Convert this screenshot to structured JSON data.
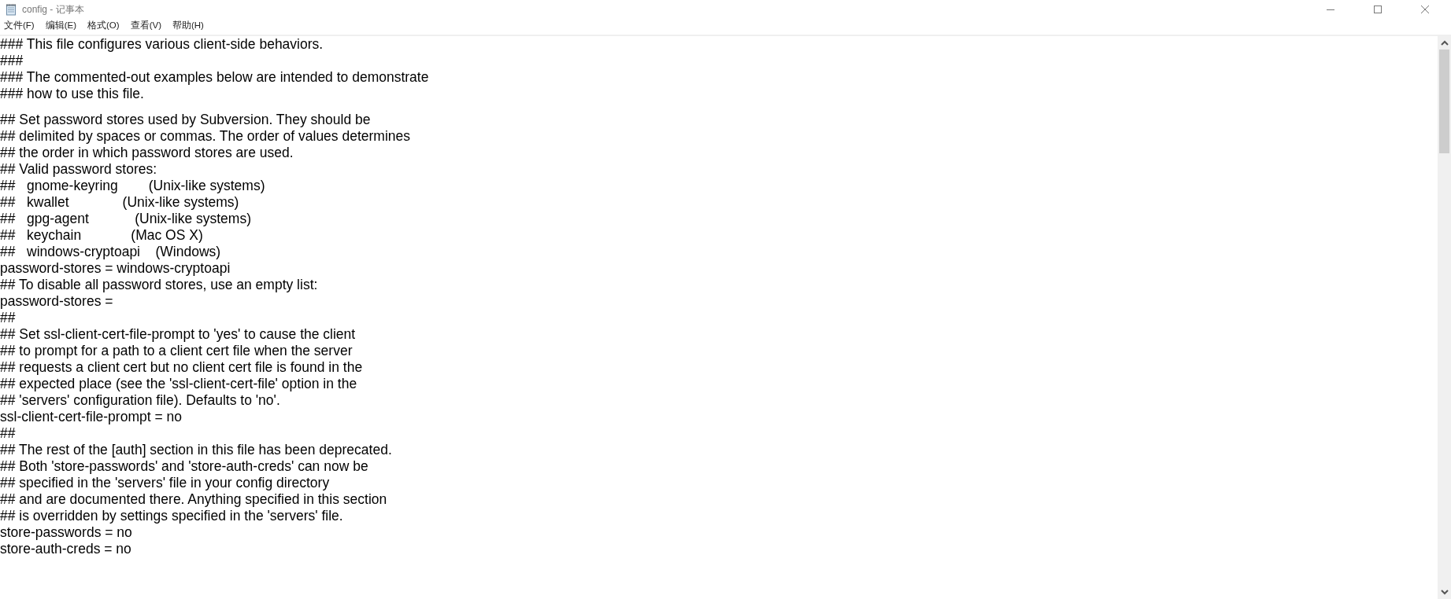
{
  "window": {
    "title": "config - 记事本"
  },
  "menu": [
    "文件(F)",
    "编辑(E)",
    "格式(O)",
    "查看(V)",
    "帮助(H)"
  ],
  "editor": {
    "blocks": [
      [
        "### This file configures various client-side behaviors.",
        "###",
        "### The commented-out examples below are intended to demonstrate",
        "### how to use this file."
      ],
      [
        "## Set password stores used by Subversion. They should be",
        "## delimited by spaces or commas. The order of values determines",
        "## the order in which password stores are used.",
        "## Valid password stores:",
        "##   gnome-keyring        (Unix-like systems)",
        "##   kwallet              (Unix-like systems)",
        "##   gpg-agent            (Unix-like systems)",
        "##   keychain             (Mac OS X)",
        "##   windows-cryptoapi    (Windows)",
        "password-stores = windows-cryptoapi",
        "## To disable all password stores, use an empty list:",
        "password-stores =",
        "##",
        "## Set ssl-client-cert-file-prompt to 'yes' to cause the client",
        "## to prompt for a path to a client cert file when the server",
        "## requests a client cert but no client cert file is found in the",
        "## expected place (see the 'ssl-client-cert-file' option in the",
        "## 'servers' configuration file). Defaults to 'no'.",
        "ssl-client-cert-file-prompt = no",
        "##",
        "## The rest of the [auth] section in this file has been deprecated.",
        "## Both 'store-passwords' and 'store-auth-creds' can now be",
        "## specified in the 'servers' file in your config directory",
        "## and are documented there. Anything specified in this section",
        "## is overridden by settings specified in the 'servers' file.",
        "store-passwords = no",
        "store-auth-creds = no"
      ]
    ]
  }
}
